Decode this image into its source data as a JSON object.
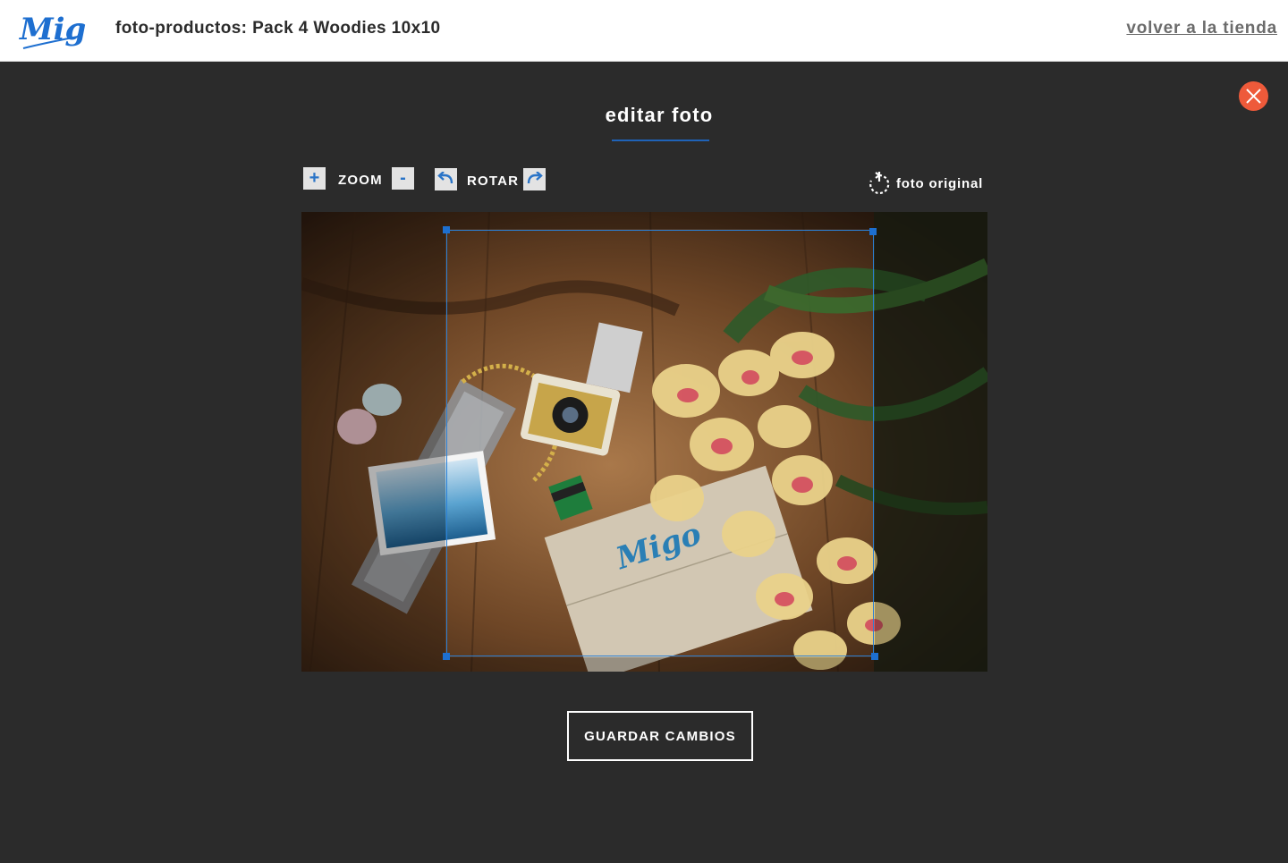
{
  "header": {
    "logo_text": "Migo",
    "title": "foto-productos: Pack 4 Woodies 10x10",
    "back_link": "volver a la tienda"
  },
  "editor": {
    "title": "editar foto",
    "zoom_in_label": "+",
    "zoom_label": "ZOOM",
    "zoom_out_label": "-",
    "rotate_label": "ROTAR",
    "original_label": "foto original",
    "save_label": "GUARDAR CAMBIOS"
  },
  "photo": {
    "description_icon": "photo-icon"
  },
  "colors": {
    "accent": "#1f63b8",
    "close": "#ee5a3a",
    "background": "#2b2b2b"
  }
}
